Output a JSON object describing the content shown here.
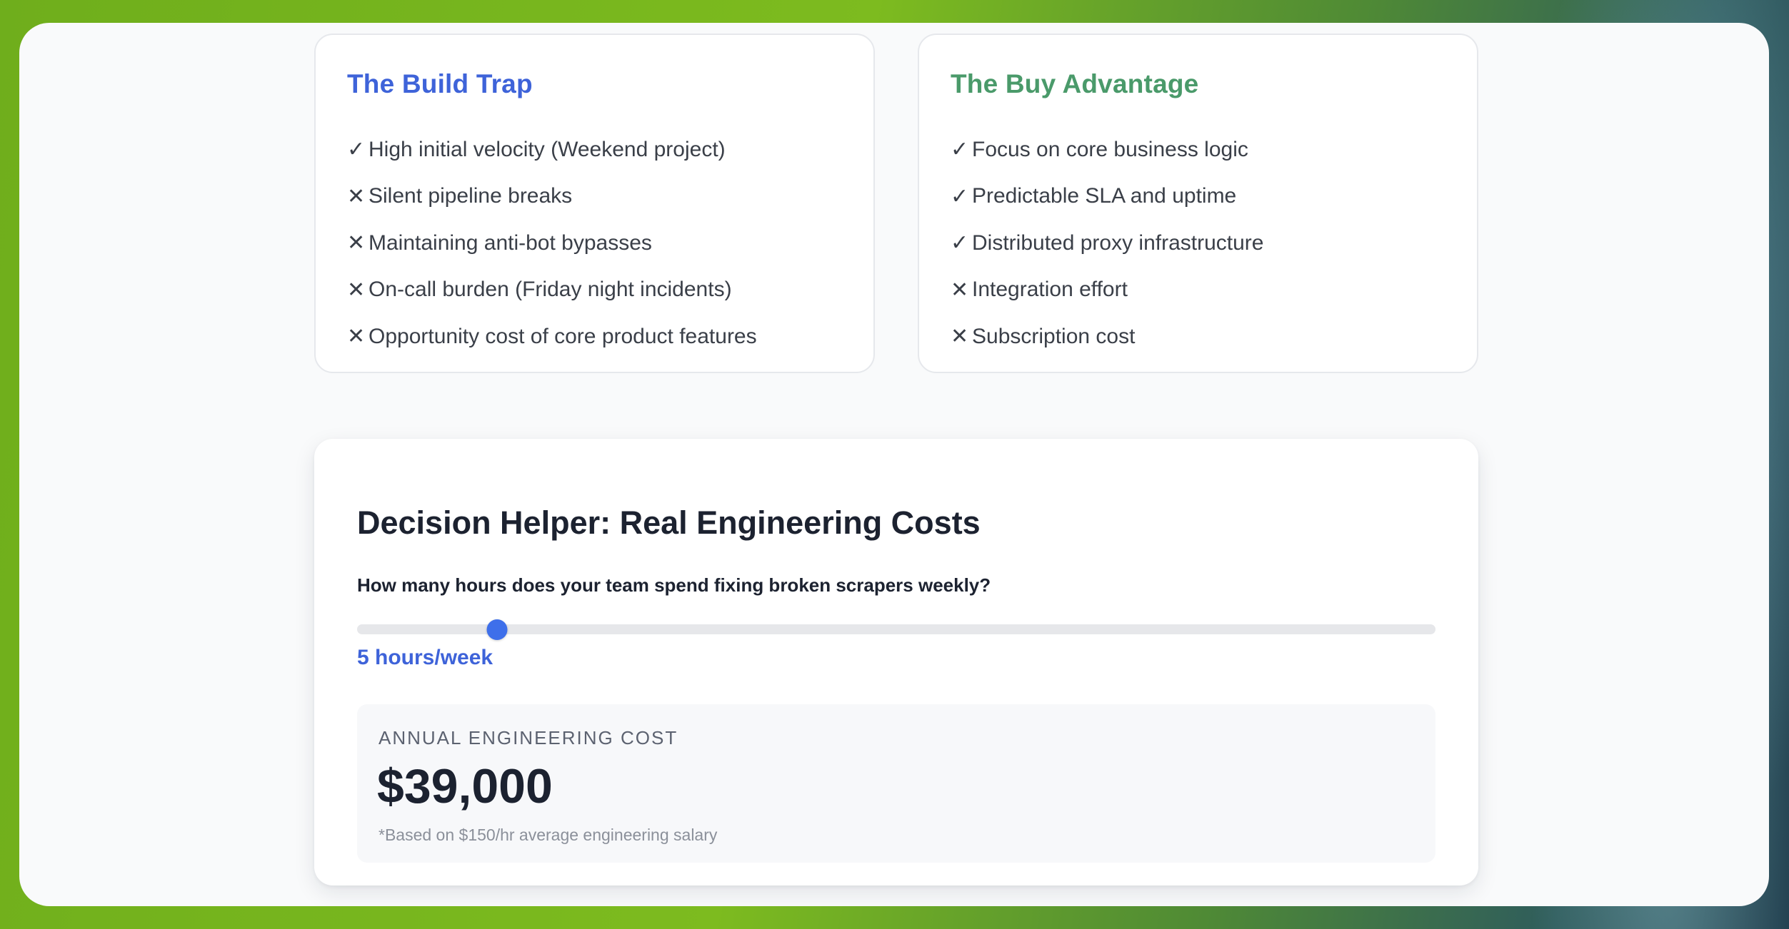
{
  "build_card": {
    "title": "The Build Trap",
    "items": [
      {
        "mark": "✓",
        "mark_icon": "check-icon",
        "text": "High initial velocity (Weekend project)"
      },
      {
        "mark": "✕",
        "mark_icon": "cross-icon",
        "text": "Silent pipeline breaks"
      },
      {
        "mark": "✕",
        "mark_icon": "cross-icon",
        "text": "Maintaining anti-bot bypasses"
      },
      {
        "mark": "✕",
        "mark_icon": "cross-icon",
        "text": "On-call burden (Friday night incidents)"
      },
      {
        "mark": "✕",
        "mark_icon": "cross-icon",
        "text": "Opportunity cost of core product features"
      }
    ]
  },
  "buy_card": {
    "title": "The Buy Advantage",
    "items": [
      {
        "mark": "✓",
        "mark_icon": "check-icon",
        "text": "Focus on core business logic"
      },
      {
        "mark": "✓",
        "mark_icon": "check-icon",
        "text": "Predictable SLA and uptime"
      },
      {
        "mark": "✓",
        "mark_icon": "check-icon",
        "text": "Distributed proxy infrastructure"
      },
      {
        "mark": "✕",
        "mark_icon": "cross-icon",
        "text": "Integration effort"
      },
      {
        "mark": "✕",
        "mark_icon": "cross-icon",
        "text": "Subscription cost"
      }
    ]
  },
  "decision": {
    "title": "Decision Helper: Real Engineering Costs",
    "question": "How many hours does your team spend fixing broken scrapers weekly?",
    "slider": {
      "value_fraction": 0.13
    },
    "slider_value_label": "5 hours/week",
    "result_label": "ANNUAL ENGINEERING COST",
    "result_amount": "$39,000",
    "result_note": "*Based on $150/hr average engineering salary"
  },
  "colors": {
    "build_accent": "#3e63d9",
    "buy_accent": "#4a9a6a",
    "slider_thumb": "#3e6fea"
  }
}
